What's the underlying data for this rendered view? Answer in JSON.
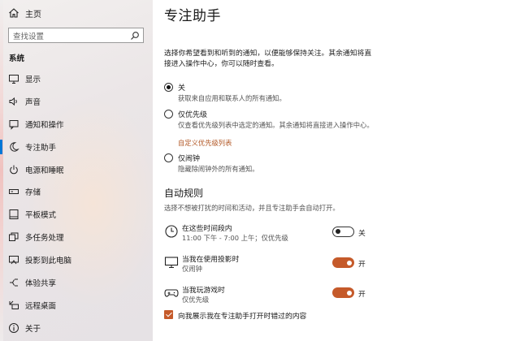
{
  "sidebar": {
    "home_label": "主页",
    "search_placeholder": "查找设置",
    "section_title": "系统",
    "items": [
      {
        "label": "显示",
        "icon": "monitor-icon"
      },
      {
        "label": "声音",
        "icon": "speaker-icon"
      },
      {
        "label": "通知和操作",
        "icon": "notification-icon"
      },
      {
        "label": "专注助手",
        "icon": "moon-icon",
        "active": true
      },
      {
        "label": "电源和睡眠",
        "icon": "power-icon"
      },
      {
        "label": "存储",
        "icon": "storage-icon"
      },
      {
        "label": "平板模式",
        "icon": "tablet-icon"
      },
      {
        "label": "多任务处理",
        "icon": "multitask-icon"
      },
      {
        "label": "投影到此电脑",
        "icon": "project-icon"
      },
      {
        "label": "体验共享",
        "icon": "share-icon"
      },
      {
        "label": "远程桌面",
        "icon": "remote-desktop-icon"
      },
      {
        "label": "关于",
        "icon": "info-icon"
      }
    ]
  },
  "main": {
    "title": "专注助手",
    "intro": "选择你希望看到和听到的通知，以便能够保持关注。其余通知将直接进入操作中心，你可以随时查看。",
    "options": [
      {
        "title": "关",
        "desc": "获取来自应用和联系人的所有通知。",
        "checked": true
      },
      {
        "title": "仅优先级",
        "desc": "仅查看优先级列表中选定的通知。其余通知将直接进入操作中心。",
        "link": "自定义优先级列表",
        "checked": false
      },
      {
        "title": "仅闹钟",
        "desc": "隐藏除闹钟外的所有通知。",
        "checked": false
      }
    ],
    "auto_rules": {
      "heading": "自动规则",
      "desc": "选择不想被打扰的时间和活动，并且专注助手会自动打开。",
      "rules": [
        {
          "title": "在这些时间段内",
          "desc": "11:00 下午 - 7:00 上午；仅优先级",
          "state": "关",
          "on": false,
          "icon": "clock-icon"
        },
        {
          "title": "当我在使用投影时",
          "desc": "仅闹钟",
          "state": "开",
          "on": true,
          "icon": "monitor-icon"
        },
        {
          "title": "当我玩游戏时",
          "desc": "仅优先级",
          "state": "开",
          "on": true,
          "icon": "gamepad-icon"
        }
      ]
    },
    "checkbox_label": "向我展示我在专注助手打开时错过的内容",
    "accent_color": "#c55a2a"
  }
}
